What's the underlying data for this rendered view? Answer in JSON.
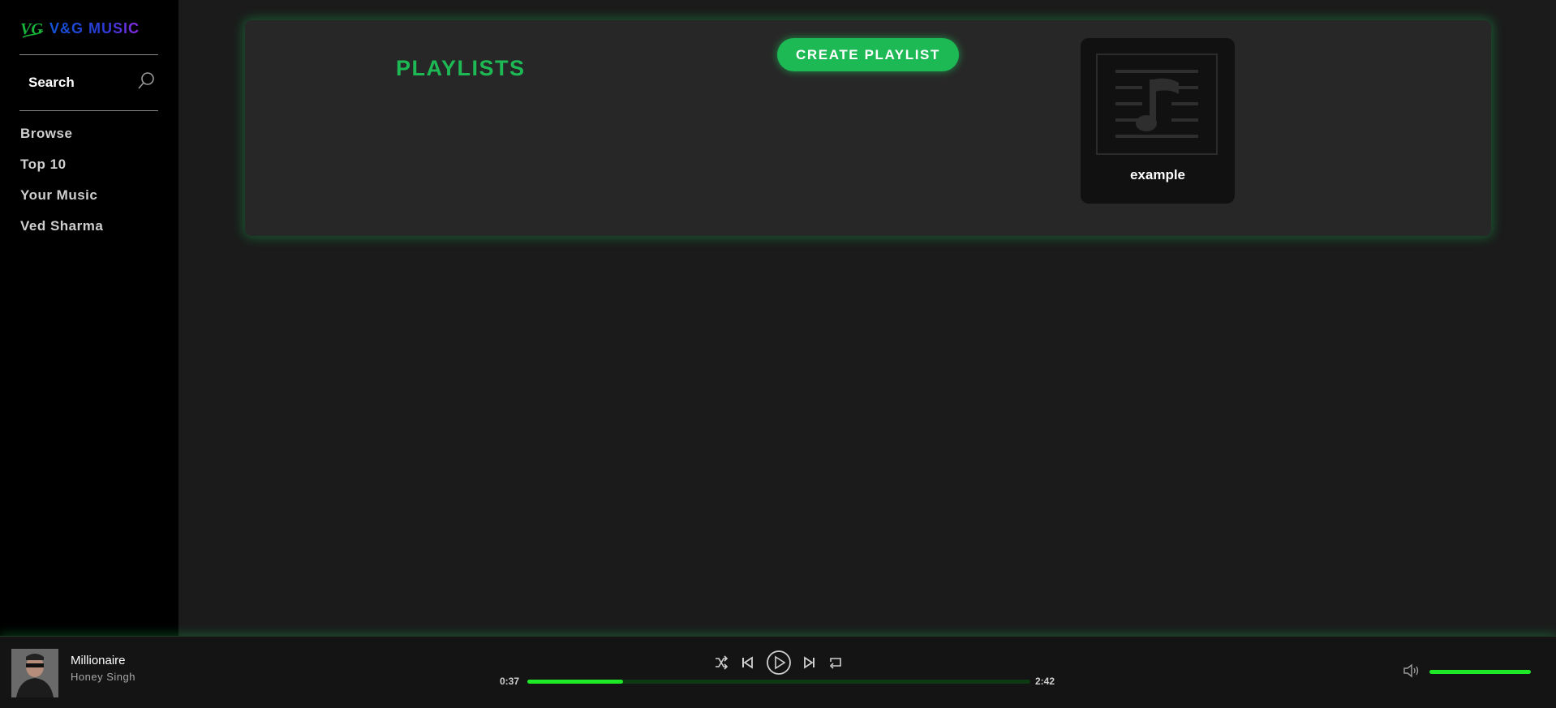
{
  "app": {
    "logo_mark": "VG",
    "name": "V&G MUSIC",
    "brand_colors": [
      "#1455d9",
      "#8a2be2"
    ],
    "accent_color": "#1db954"
  },
  "sidebar": {
    "search_label": "Search",
    "search_icon": "search-icon",
    "items": [
      {
        "label": "Browse"
      },
      {
        "label": "Top 10"
      },
      {
        "label": "Your Music"
      },
      {
        "label": "Ved Sharma"
      }
    ]
  },
  "main": {
    "title": "PLAYLISTS",
    "create_button": "CREATE PLAYLIST",
    "playlists": [
      {
        "name": "example",
        "icon": "music-note-icon"
      }
    ]
  },
  "player": {
    "track_title": "Millionaire",
    "artist": "Honey Singh",
    "current_time": "0:37",
    "total_time": "2:42",
    "progress": 0.19,
    "volume": 1.0,
    "controls": [
      "shuffle-icon",
      "previous-icon",
      "play-icon",
      "next-icon",
      "repeat-icon"
    ],
    "volume_icon": "volume-icon"
  }
}
